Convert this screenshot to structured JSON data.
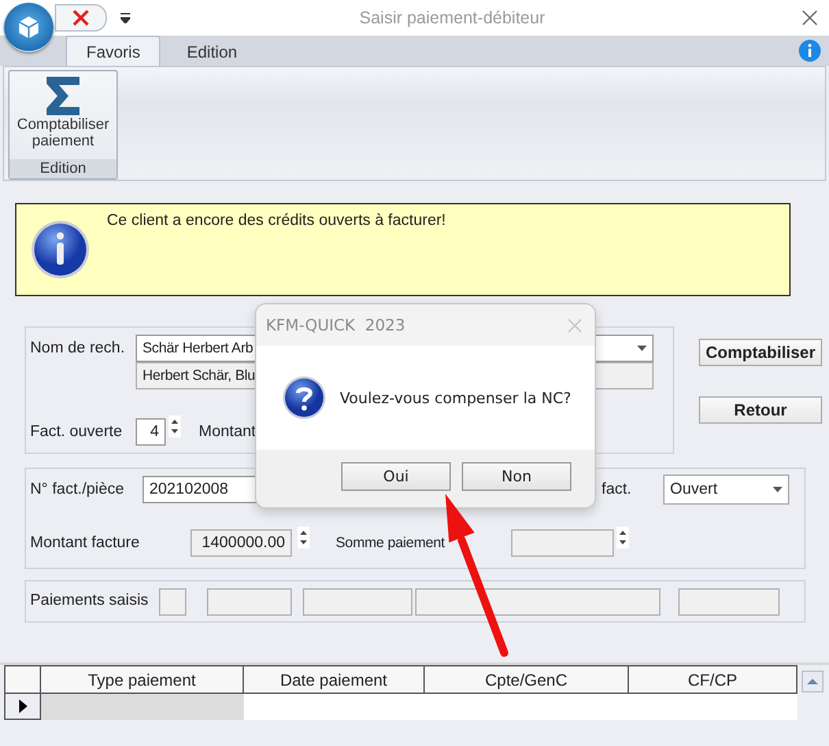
{
  "window": {
    "title": "Saisir paiement-débiteur"
  },
  "ribbon": {
    "tabs": [
      {
        "label": "Favoris",
        "selected": true
      },
      {
        "label": "Edition",
        "selected": false
      }
    ],
    "command": "Comptabiliser paiement",
    "group": "Edition"
  },
  "message": "Ce client a encore des crédits ouverts à facturer!",
  "customer": {
    "label": "Nom de rech.",
    "search": "Schär Herbert Arb",
    "address": "Herbert Schär, Blu",
    "open_label": "Fact. ouverte",
    "open_count": "4",
    "amount_label": "Montant"
  },
  "actions": [
    "Comptabiliser",
    "Retour"
  ],
  "invoice": {
    "number_label": "N° fact./pièce",
    "number": "202102008",
    "status_label": "fact.",
    "status": "Ouvert",
    "amount_label": "Montant facture",
    "amount": "1400000.00",
    "sum_label": "Somme paiement"
  },
  "payments": {
    "label": "Paiements saisis"
  },
  "grid": {
    "columns": [
      "Type paiement",
      "Date paiement",
      "Cpte/GenC",
      "CF/CP"
    ]
  },
  "dialog": {
    "title": "KFM-QUICK  2023",
    "message": "Voulez-vous compenser la NC?",
    "buttons": [
      "Oui",
      "Non"
    ]
  }
}
